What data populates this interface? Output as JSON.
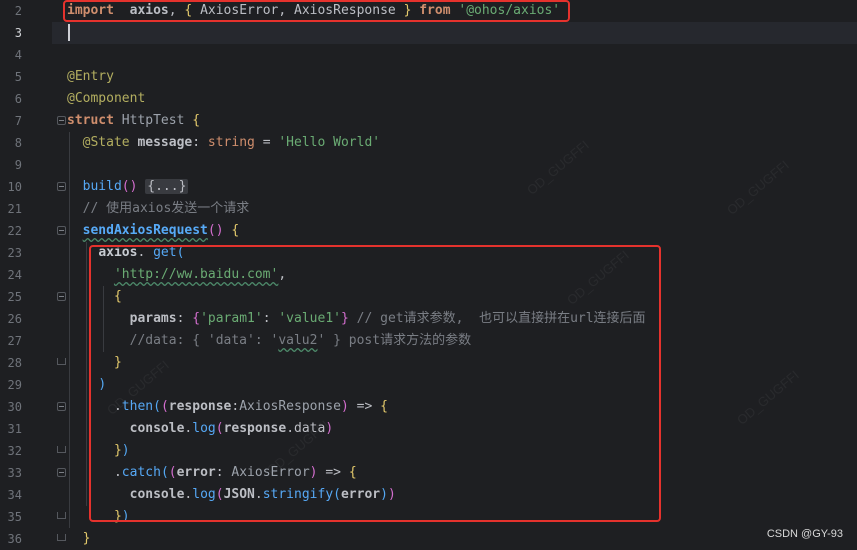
{
  "editor": {
    "language": "ArkTS",
    "active_line": "3",
    "lines": [
      {
        "n": "2",
        "segs": [
          [
            "k",
            "import"
          ],
          [
            "",
            "  "
          ],
          [
            "id",
            "axios"
          ],
          [
            "",
            ", "
          ],
          [
            "br",
            "{"
          ],
          [
            "",
            " AxiosError, AxiosResponse "
          ],
          [
            "br",
            "}"
          ],
          [
            "",
            " "
          ],
          [
            "k",
            "from"
          ],
          [
            "",
            " "
          ],
          [
            "s",
            "'@ohos/axios'"
          ]
        ]
      },
      {
        "n": "3",
        "segs": []
      },
      {
        "n": "4",
        "segs": []
      },
      {
        "n": "5",
        "segs": [
          [
            "ann",
            "@Entry"
          ]
        ]
      },
      {
        "n": "6",
        "segs": [
          [
            "ann",
            "@Component"
          ]
        ]
      },
      {
        "n": "7",
        "segs": [
          [
            "k",
            "struct"
          ],
          [
            "",
            " "
          ],
          [
            "cls",
            "HttpTest"
          ],
          [
            "",
            " "
          ],
          [
            "br",
            "{"
          ]
        ]
      },
      {
        "n": "8",
        "segs": [
          [
            "",
            ""
          ],
          [
            "ann",
            "  @State"
          ],
          [
            "",
            " "
          ],
          [
            "id",
            "message"
          ],
          [
            "",
            ": "
          ],
          [
            "kw",
            "string"
          ],
          [
            "",
            " = "
          ],
          [
            "s",
            "'Hello World'"
          ]
        ]
      },
      {
        "n": "9",
        "segs": []
      },
      {
        "n": "10",
        "segs": [
          [
            "",
            "  "
          ],
          [
            "fn",
            "build"
          ],
          [
            "",
            ""
          ],
          [
            "br2",
            "()"
          ],
          [
            "",
            " "
          ],
          [
            "fold",
            "{...}"
          ]
        ]
      },
      {
        "n": "21",
        "segs": [
          [
            "cm",
            "  // 使用axios发送一个请求"
          ]
        ]
      },
      {
        "n": "22",
        "segs": [
          [
            "",
            "  "
          ],
          [
            "fnu",
            "sendAxiosRequest"
          ],
          [
            "br2",
            "()"
          ],
          [
            "",
            " "
          ],
          [
            "br",
            "{"
          ]
        ]
      },
      {
        "n": "23",
        "segs": [
          [
            "",
            "    "
          ],
          [
            "obj",
            "axios"
          ],
          [
            "",
            ". "
          ],
          [
            "fn",
            "get"
          ],
          [
            "br3",
            "("
          ]
        ]
      },
      {
        "n": "24",
        "segs": [
          [
            "",
            "      "
          ],
          [
            "su",
            "'http://ww.baidu.com'"
          ],
          [
            "",
            ","
          ]
        ]
      },
      {
        "n": "25",
        "segs": [
          [
            "",
            "      "
          ],
          [
            "br",
            "{"
          ]
        ]
      },
      {
        "n": "26",
        "segs": [
          [
            "",
            "        "
          ],
          [
            "id",
            "params"
          ],
          [
            "",
            ": "
          ],
          [
            "br2",
            "{"
          ],
          [
            "s",
            "'param1'"
          ],
          [
            "",
            ": "
          ],
          [
            "s",
            "'value1'"
          ],
          [
            "br2",
            "}"
          ],
          [
            "cm",
            " // get请求参数,  也可以直接拼在url连接后面"
          ]
        ]
      },
      {
        "n": "27",
        "segs": [
          [
            "cm",
            "        //data: { 'data': '"
          ],
          [
            "cmu",
            "valu2"
          ],
          [
            "cm",
            "' } post请求方法的参数"
          ]
        ]
      },
      {
        "n": "28",
        "segs": [
          [
            "",
            "      "
          ],
          [
            "br",
            "}"
          ]
        ]
      },
      {
        "n": "29",
        "segs": [
          [
            "",
            "    "
          ],
          [
            "br3",
            ")"
          ]
        ]
      },
      {
        "n": "30",
        "segs": [
          [
            "",
            "      ."
          ],
          [
            "fn",
            "then"
          ],
          [
            "br3",
            "("
          ],
          [
            "br2",
            "("
          ],
          [
            "id",
            "response"
          ],
          [
            "",
            ":"
          ],
          [
            "cls",
            "AxiosResponse"
          ],
          [
            "br2",
            ")"
          ],
          [
            "",
            " => "
          ],
          [
            "br",
            "{"
          ]
        ]
      },
      {
        "n": "31",
        "segs": [
          [
            "",
            "        "
          ],
          [
            "id",
            "console"
          ],
          [
            "",
            "."
          ],
          [
            "fn",
            "log"
          ],
          [
            "br2",
            "("
          ],
          [
            "id",
            "response"
          ],
          [
            "",
            ".data"
          ],
          [
            "br2",
            ")"
          ]
        ]
      },
      {
        "n": "32",
        "segs": [
          [
            "",
            "      "
          ],
          [
            "br",
            "}"
          ],
          [
            "br3",
            ")"
          ]
        ]
      },
      {
        "n": "33",
        "segs": [
          [
            "",
            "      ."
          ],
          [
            "fn",
            "catch"
          ],
          [
            "br3",
            "("
          ],
          [
            "br2",
            "("
          ],
          [
            "id",
            "error"
          ],
          [
            "",
            ": "
          ],
          [
            "cls",
            "AxiosError"
          ],
          [
            "br2",
            ")"
          ],
          [
            "",
            " => "
          ],
          [
            "br",
            "{"
          ]
        ]
      },
      {
        "n": "34",
        "segs": [
          [
            "",
            "        "
          ],
          [
            "id",
            "console"
          ],
          [
            "",
            "."
          ],
          [
            "fn",
            "log"
          ],
          [
            "br2",
            "("
          ],
          [
            "id",
            "JSON"
          ],
          [
            "",
            "."
          ],
          [
            "fn",
            "stringify"
          ],
          [
            "br3",
            "("
          ],
          [
            "id",
            "error"
          ],
          [
            "br3",
            ")"
          ],
          [
            "br2",
            ")"
          ]
        ]
      },
      {
        "n": "35",
        "segs": [
          [
            "",
            "      "
          ],
          [
            "br",
            "}"
          ],
          [
            "br3",
            ")"
          ]
        ]
      },
      {
        "n": "36",
        "segs": [
          [
            "",
            "  "
          ],
          [
            "br",
            "}"
          ]
        ]
      }
    ]
  },
  "watermark": "CSDN @GY-93",
  "faint_marks": [
    "OD_GUGFFI",
    "OD_GUGFFI",
    "OD_GUGFFI",
    "OD_GUGFFI",
    "OD_GUGFFI",
    "OD_GUGFFI"
  ],
  "colors": {
    "highlight_box": "#e5322d",
    "background": "#1e1f22",
    "string": "#6aab73",
    "keyword": "#cf8e6d",
    "function": "#56a8f5"
  }
}
